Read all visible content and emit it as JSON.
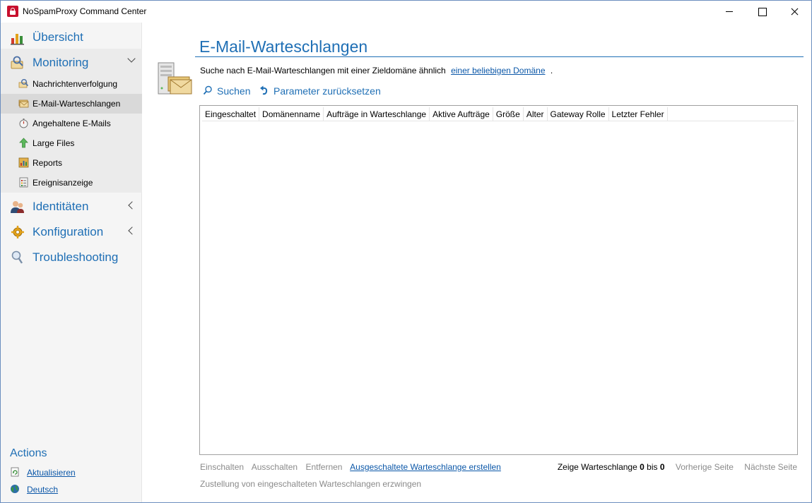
{
  "window": {
    "title": "NoSpamProxy Command Center"
  },
  "sidebar": {
    "overview": "Übersicht",
    "monitoring": "Monitoring",
    "monitoring_items": [
      "Nachrichtenverfolgung",
      "E-Mail-Warteschlangen",
      "Angehaltene E-Mails",
      "Large Files",
      "Reports",
      "Ereignisanzeige"
    ],
    "selected_item": "E-Mail-Warteschlangen",
    "identities": "Identitäten",
    "configuration": "Konfiguration",
    "troubleshooting": "Troubleshooting",
    "actions_title": "Actions",
    "actions": [
      "Aktualisieren",
      "Deutsch"
    ]
  },
  "main": {
    "title": "E-Mail-Warteschlangen",
    "search_prefix": "Suche nach E-Mail-Warteschlangen mit einer Zieldomäne ähnlich",
    "search_link": "einer beliebigen Domäne",
    "search_suffix": ".",
    "search_button": "Suchen",
    "reset_button": "Parameter zurücksetzen",
    "columns": [
      "Eingeschaltet",
      "Domänenname",
      "Aufträge in Warteschlange",
      "Aktive Aufträge",
      "Größe",
      "Alter",
      "Gateway Rolle",
      "Letzter Fehler"
    ],
    "footer": {
      "enable": "Einschalten",
      "disable": "Ausschalten",
      "remove": "Entfernen",
      "create_disabled": "Ausgeschaltete Warteschlange erstellen",
      "force_delivery": "Zustellung von eingeschalteten Warteschlangen erzwingen",
      "pager_prefix": "Zeige Warteschlange",
      "pager_from": "0",
      "pager_mid": "bis",
      "pager_to": "0",
      "prev_page": "Vorherige Seite",
      "next_page": "Nächste Seite"
    }
  },
  "colors": {
    "accent": "#1f6fb5",
    "link": "#0b57a8",
    "disabled": "#8a8a8a",
    "sidebar_bg": "#f5f5f5",
    "selected_bg": "#d9d9d9"
  }
}
